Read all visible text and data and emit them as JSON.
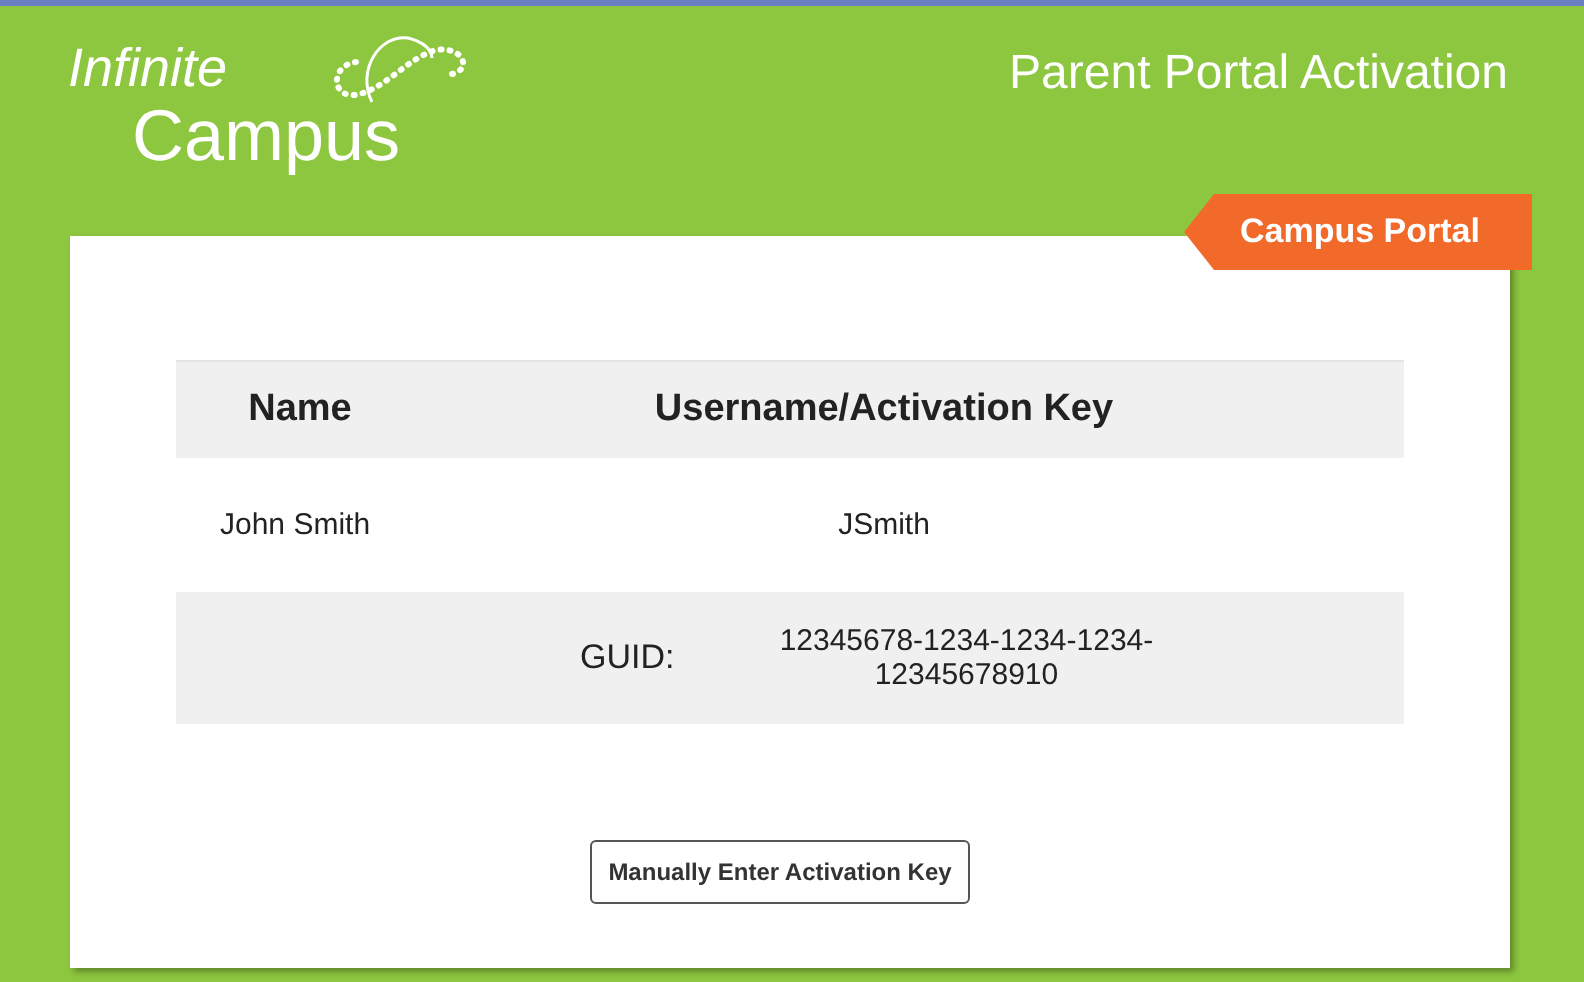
{
  "header": {
    "logo": {
      "line_1": "Infinite",
      "line_2": "Campus"
    },
    "title": "Parent Portal Activation"
  },
  "ribbon": "Campus Portal",
  "table": {
    "columns": [
      "Name",
      "Username/Activation Key"
    ],
    "rows": [
      {
        "name": "John Smith",
        "username": "JSmith"
      }
    ],
    "guid": {
      "label": "GUID:",
      "value": "12345678-1234-1234-1234-12345678910"
    }
  },
  "button": "Manually Enter Activation Key"
}
